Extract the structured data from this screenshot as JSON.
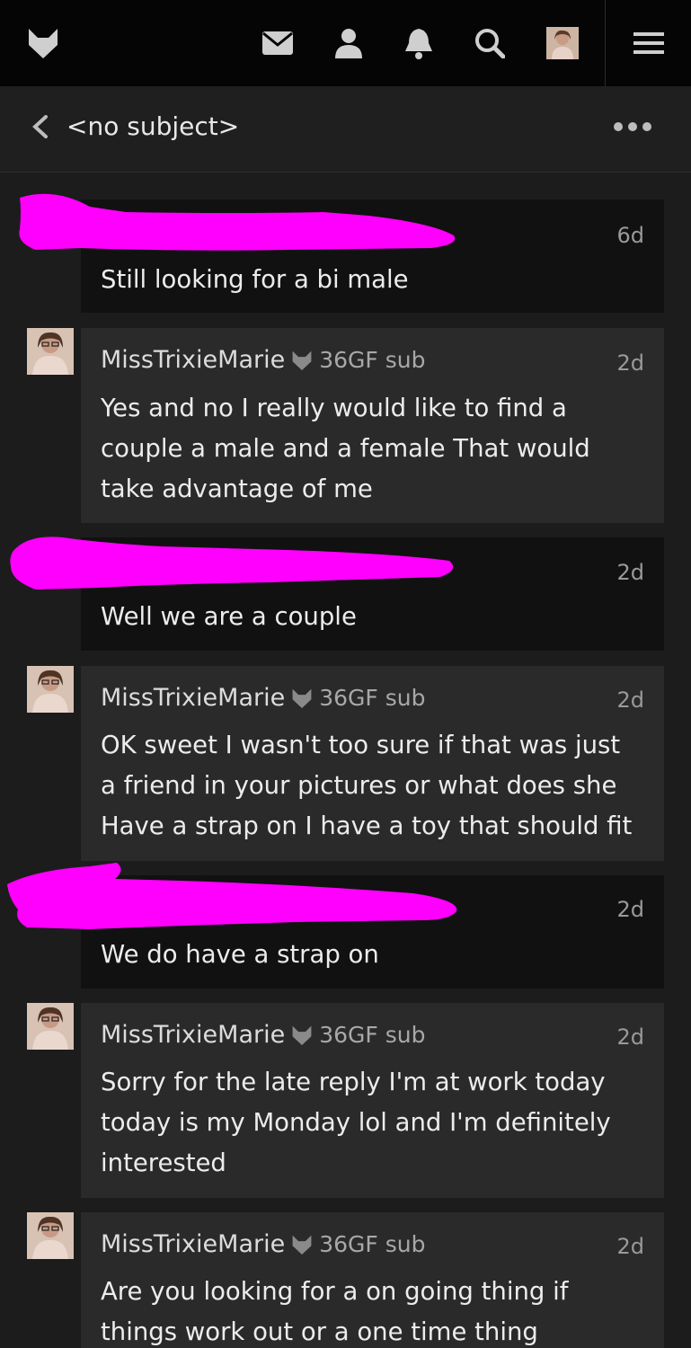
{
  "nav": {
    "icons": [
      "fox-logo-icon",
      "mail-icon",
      "user-icon",
      "bell-icon",
      "search-icon",
      "avatar",
      "menu-icon"
    ]
  },
  "header": {
    "title": "<no subject>"
  },
  "messages": [
    {
      "sender": "",
      "time": "6d",
      "body": "Still looking for a bi male"
    },
    {
      "sender": "MissTrixieMarie",
      "meta": "36GF sub",
      "time": "2d",
      "body": "Yes and no I really would like to find a couple a male and a female That would take advantage of me"
    },
    {
      "sender": "",
      "time": "2d",
      "body": "Well we are a couple"
    },
    {
      "sender": "MissTrixieMarie",
      "meta": "36GF sub",
      "time": "2d",
      "body": "OK sweet I wasn't too sure if that was just a friend in your pictures or what does she Have a strap on I have a toy that should fit"
    },
    {
      "sender": "",
      "time": "2d",
      "body": "We do have a strap on"
    },
    {
      "sender": "MissTrixieMarie",
      "meta": "36GF sub",
      "time": "2d",
      "body": "Sorry for the late reply I'm at work today today is my Monday lol and I'm definitely interested"
    },
    {
      "sender": "MissTrixieMarie",
      "meta": "36GF sub",
      "time": "2d",
      "body": "Are you looking for a on going thing if things work out or a one time thing"
    }
  ],
  "colors": {
    "redaction": "#ff00ff",
    "top_bar": "#050505",
    "their_bubble": "#111111",
    "my_bubble": "#2a2a2a"
  }
}
